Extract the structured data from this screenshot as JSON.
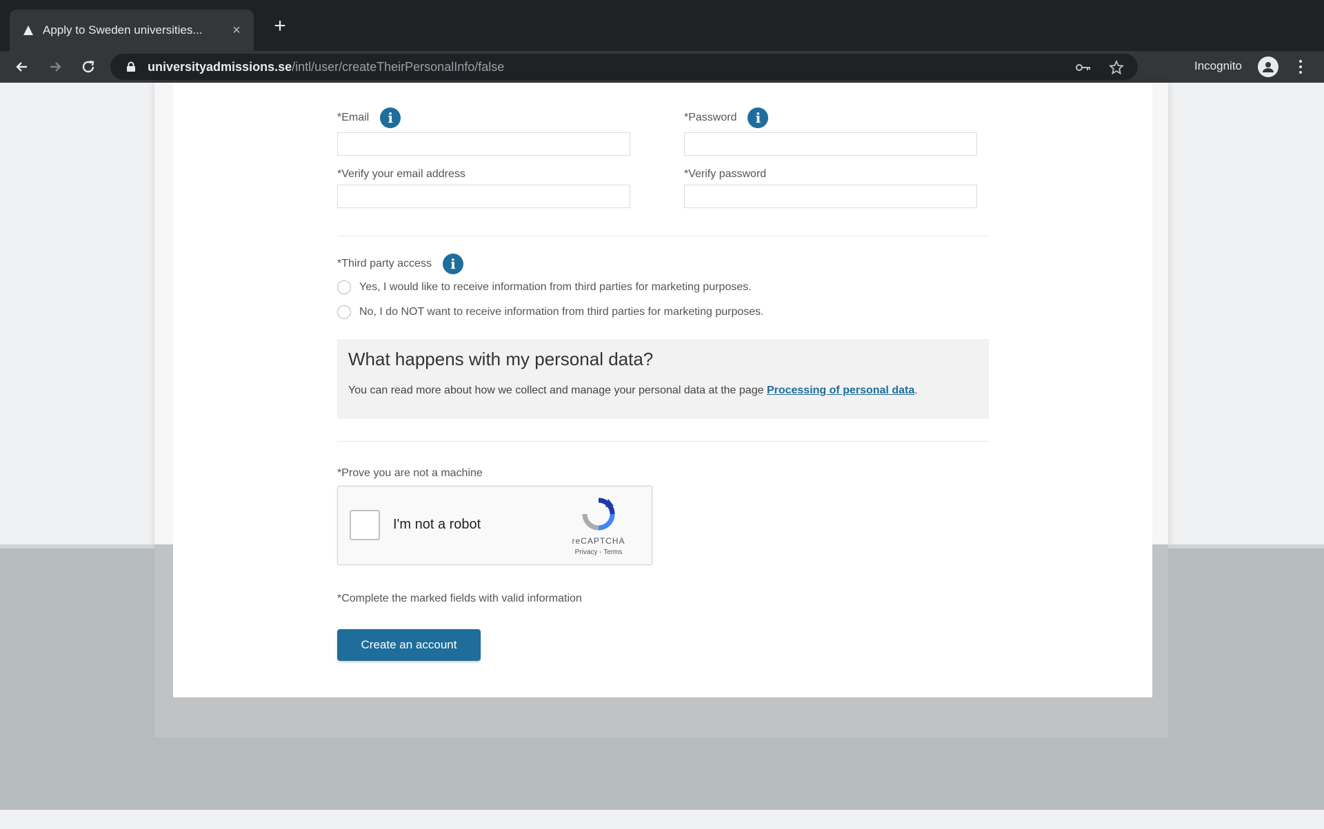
{
  "browser": {
    "tab_title": "Apply to Sweden universities...",
    "tab_close": "×",
    "new_tab": "+",
    "url_host": "universityadmissions.se",
    "url_path": "/intl/user/createTheirPersonalInfo/false",
    "profile_label": "Incognito"
  },
  "form": {
    "email_label": "*Email",
    "password_label": "*Password",
    "verify_email_label": "*Verify your email address",
    "verify_password_label": "*Verify password",
    "third_party_label": "*Third party access",
    "third_party_yes": "Yes, I would like to receive information from third parties for marketing purposes.",
    "third_party_no": "No, I do NOT want to receive information from third parties for marketing purposes.",
    "info_icon_glyph": "i"
  },
  "personal_data": {
    "heading": "What happens with my personal data?",
    "text": "You can read more about how we collect and manage your personal data at the page ",
    "link": "Processing of personal data",
    "after_link": "."
  },
  "captcha": {
    "prompt": "*Prove you are not a machine",
    "label": "I'm not a robot",
    "brand": "reCAPTCHA",
    "links": "Privacy - Terms"
  },
  "footer": {
    "required_note": "*Complete the marked fields with valid information",
    "submit_label": "Create an account"
  },
  "colors": {
    "accent": "#1f6d9b",
    "browser_dark": "#202124"
  }
}
